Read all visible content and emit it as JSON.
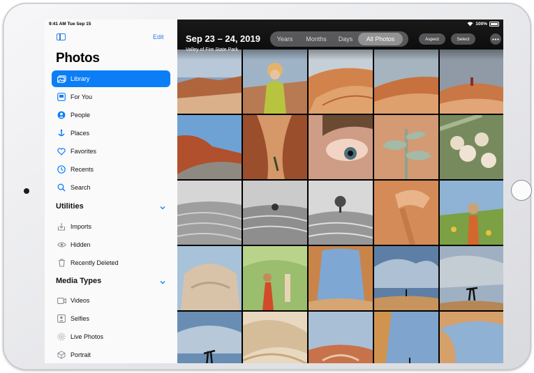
{
  "status_bar": {
    "time_date": "9:41 AM  Tue Sep 15",
    "battery": "100%"
  },
  "sidebar": {
    "edit_label": "Edit",
    "title": "Photos",
    "items": [
      {
        "label": "Library",
        "icon": "photo-library-icon",
        "active": true
      },
      {
        "label": "For You",
        "icon": "for-you-icon"
      },
      {
        "label": "People",
        "icon": "people-icon"
      },
      {
        "label": "Places",
        "icon": "places-icon"
      },
      {
        "label": "Favorites",
        "icon": "heart-icon"
      },
      {
        "label": "Recents",
        "icon": "clock-icon"
      },
      {
        "label": "Search",
        "icon": "search-icon"
      }
    ],
    "utilities": {
      "header": "Utilities",
      "items": [
        {
          "label": "Imports",
          "icon": "import-icon"
        },
        {
          "label": "Hidden",
          "icon": "eye-slash-icon"
        },
        {
          "label": "Recently Deleted",
          "icon": "trash-icon"
        }
      ]
    },
    "media_types": {
      "header": "Media Types",
      "items": [
        {
          "label": "Videos",
          "icon": "video-icon"
        },
        {
          "label": "Selfies",
          "icon": "selfie-icon"
        },
        {
          "label": "Live Photos",
          "icon": "live-photo-icon"
        },
        {
          "label": "Portrait",
          "icon": "cube-icon"
        }
      ]
    }
  },
  "main": {
    "date_range": "Sep 23 – 24, 2019",
    "location": "Valley of Fire State Park",
    "views": [
      "Years",
      "Months",
      "Days",
      "All Photos"
    ],
    "active_view": "All Photos",
    "aspect_label": "Aspect",
    "select_label": "Select"
  },
  "colors": {
    "accent": "#0b7ef7",
    "sidebar_bg": "#fafafa"
  }
}
